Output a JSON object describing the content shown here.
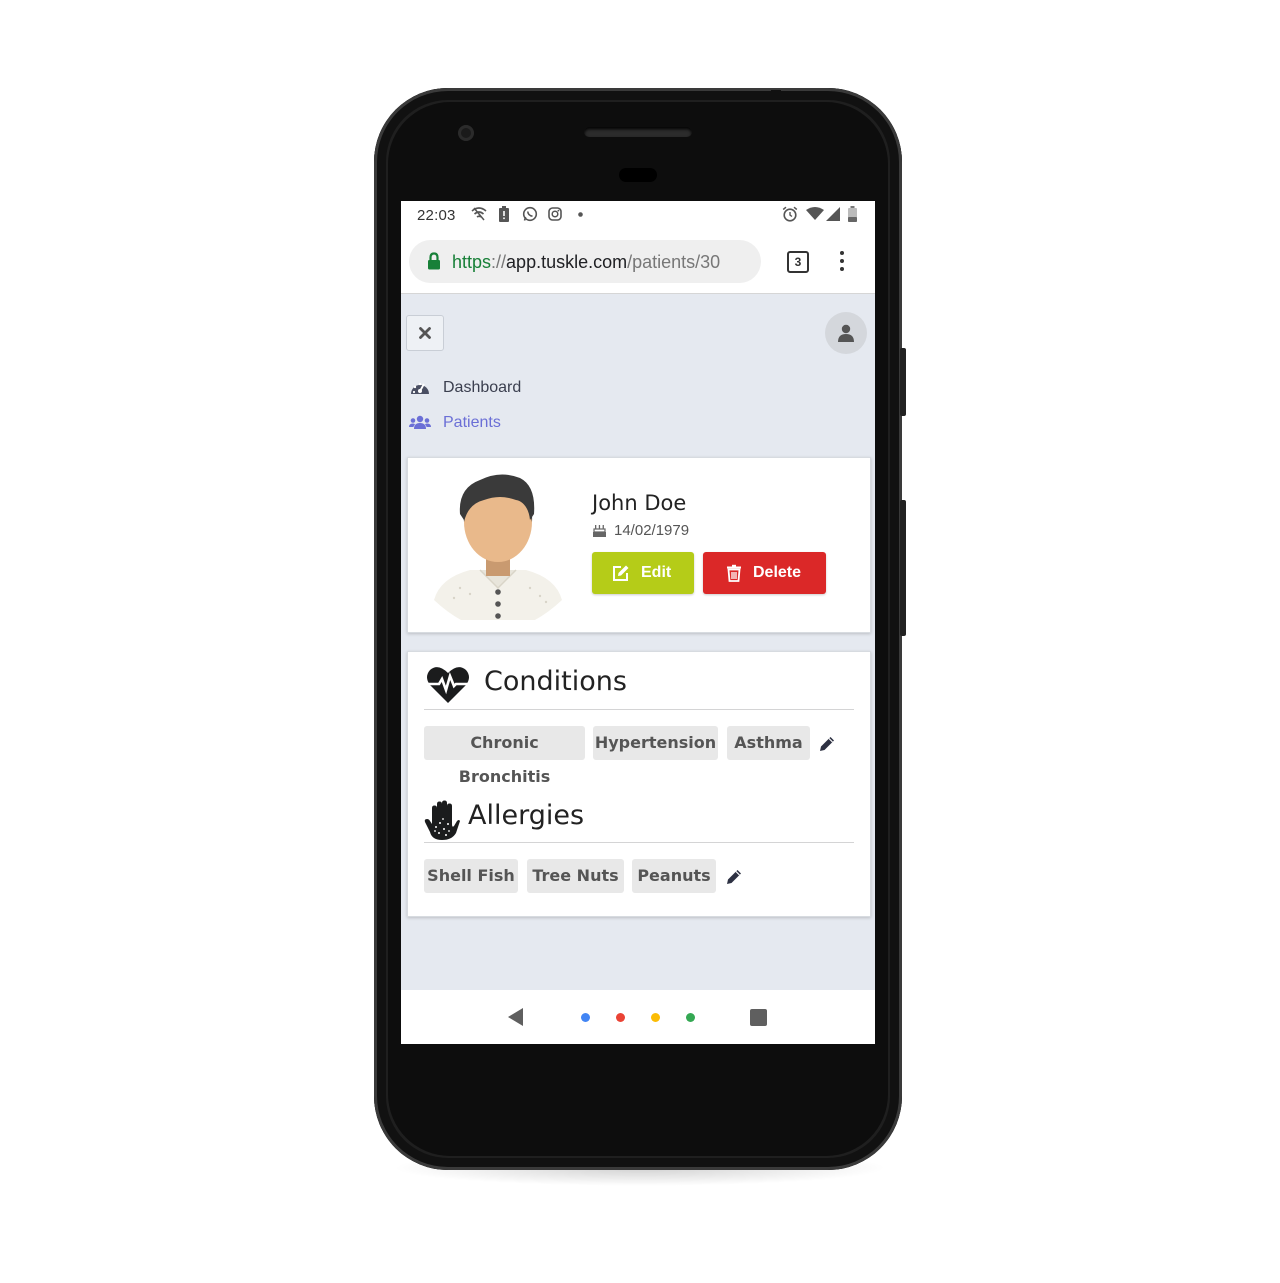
{
  "statusbar": {
    "time": "22:03",
    "icons": [
      "wifi-off-icon",
      "battery-alert-icon",
      "whatsapp-icon",
      "instagram-icon",
      "dot-icon",
      "alarm-icon",
      "wifi-icon",
      "signal-icon",
      "battery-icon"
    ]
  },
  "browser": {
    "url_scheme": "https",
    "url_sep": "://",
    "url_host": "app.tuskle.com",
    "url_path": "/patients/30",
    "tab_count": "3",
    "colors": {
      "secure": "#188038"
    }
  },
  "nav": {
    "items": [
      {
        "label": "Dashboard",
        "icon": "dashboard-icon",
        "active": false
      },
      {
        "label": "Patients",
        "icon": "users-icon",
        "active": true
      }
    ]
  },
  "patient": {
    "name": "John Doe",
    "dob": "14/02/1979",
    "edit_label": "Edit",
    "delete_label": "Delete",
    "colors": {
      "edit": "#b5cc18",
      "delete": "#db2828"
    }
  },
  "conditions": {
    "title": "Conditions",
    "icon": "heartbeat-icon",
    "tags": [
      "Chronic Bronchitis",
      "Hypertension",
      "Asthma"
    ]
  },
  "allergies": {
    "title": "Allergies",
    "icon": "allergy-hand-icon",
    "tags": [
      "Shell Fish",
      "Tree Nuts",
      "Peanuts"
    ]
  },
  "android_nav": {
    "colors": [
      "#4285f4",
      "#ea4335",
      "#fbbc05",
      "#34a853"
    ]
  }
}
